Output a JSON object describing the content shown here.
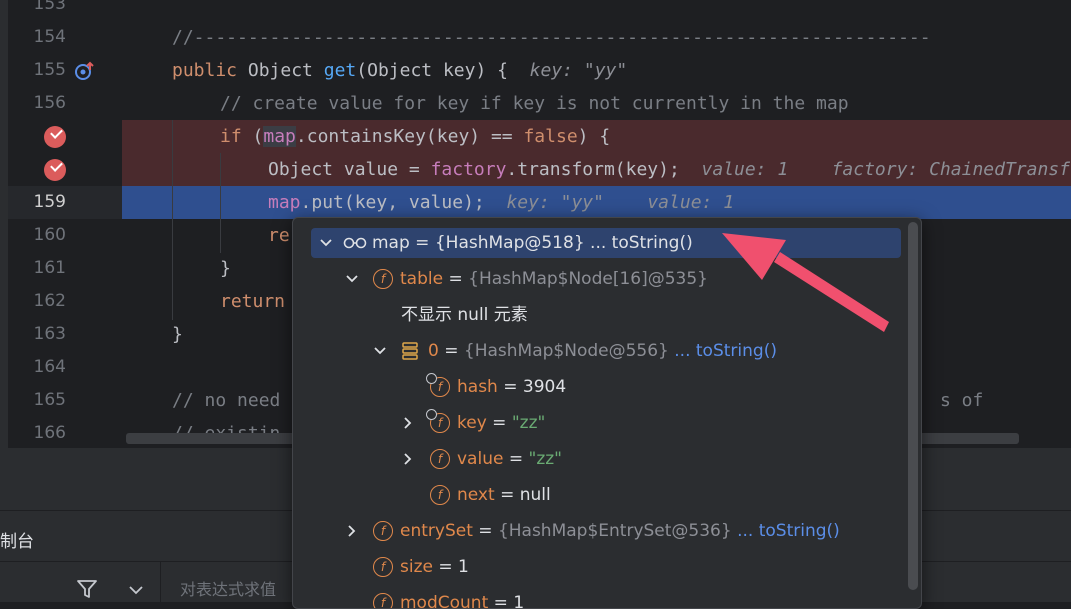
{
  "editor": {
    "line_numbers": [
      "153",
      "154",
      "155",
      "156",
      "",
      "",
      "159",
      "160",
      "161",
      "162",
      "163",
      "164",
      "165",
      "166"
    ],
    "lines": {
      "l154": "//--------------------------------------------------------------------",
      "l155_kw": "public",
      "l155_type": "Object",
      "l155_fn": "get",
      "l155_sig": "(Object key) {",
      "l155_hint": "key: \"yy\"",
      "l156": "// create value for key if key is not currently in the map",
      "l157_if": "if",
      "l157_open": " (",
      "l157_map": "map",
      "l157_rest": ".containsKey(key) == ",
      "l157_false": "false",
      "l157_close": ") {",
      "l158_decl": "Object value = ",
      "l158_factory": "factory",
      "l158_rest": ".transform(key);",
      "l158_hint1": "value: 1",
      "l158_hint2": "factory: ChainedTransformer",
      "l159_map": "map",
      "l159_rest": ".put(key, value);",
      "l159_hint1": "key: \"yy\"",
      "l159_hint2": "value: 1",
      "l160": "re",
      "l161": "}",
      "l162": "return",
      "l163": "}",
      "l165_left": "// no need",
      "l165_right": "s of",
      "l166_left": "// existin",
      "l166_right": "."
    }
  },
  "popup": {
    "root": {
      "name": "map",
      "eq": " = ",
      "type": "{HashMap@518}",
      "link": " ... toString()"
    },
    "table": {
      "name": "table",
      "eq": " = ",
      "type": "{HashMap$Node[16]@535}"
    },
    "null_note": "不显示 null 元素",
    "node0": {
      "name": "0",
      "eq": " = ",
      "type": "{HashMap$Node@556}",
      "link": " ... toString()"
    },
    "hash": {
      "name": "hash",
      "eq": " = ",
      "value": "3904"
    },
    "key": {
      "name": "key",
      "eq": " = ",
      "value": "\"zz\""
    },
    "value": {
      "name": "value",
      "eq": " = ",
      "value": "\"zz\""
    },
    "next": {
      "name": "next",
      "eq": " = ",
      "value": "null"
    },
    "entrySet": {
      "name": "entrySet",
      "eq": " = ",
      "type": "{HashMap$EntrySet@536}",
      "link": " ... toString()"
    },
    "size": {
      "name": "size",
      "eq": " = ",
      "value": "1"
    },
    "modCount": {
      "name": "modCount",
      "eq": " = ",
      "value": "1"
    },
    "field_icon": "f"
  },
  "bottom": {
    "console_label": "制台",
    "eval_placeholder": "对表达式求值"
  },
  "colors": {
    "breakpoint_row": "#4a2a2d",
    "exec_row": "#2f4f8f",
    "annotation_arrow": "#f0506e"
  }
}
